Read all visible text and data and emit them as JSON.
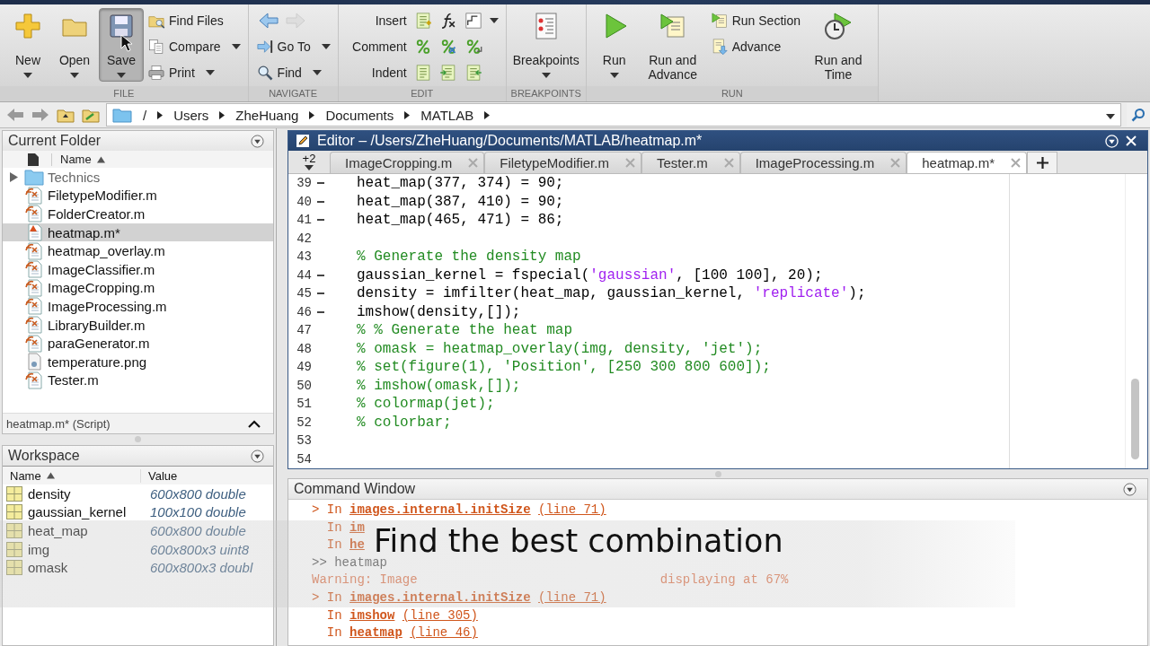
{
  "toolstrip": {
    "sections": [
      {
        "title": "FILE",
        "items": [
          {
            "kind": "large",
            "label": "New",
            "dropdown": true,
            "pressed": false
          },
          {
            "kind": "large",
            "label": "Open",
            "dropdown": true,
            "pressed": false
          },
          {
            "kind": "large",
            "label": "Save",
            "dropdown": true,
            "pressed": true
          },
          {
            "kind": "stack",
            "buttons": [
              {
                "label": "Find Files",
                "dropdown": false
              },
              {
                "label": "Compare",
                "dropdown": true
              },
              {
                "label": "Print",
                "dropdown": true
              }
            ]
          }
        ]
      },
      {
        "title": "NAVIGATE",
        "items": [
          {
            "kind": "stack",
            "buttons": [
              {
                "kind": "arrows",
                "forward_disabled": true
              },
              {
                "label": "Go To",
                "dropdown": true
              },
              {
                "label": "Find",
                "dropdown": true
              }
            ]
          }
        ]
      },
      {
        "title": "EDIT",
        "items": [
          {
            "kind": "rows",
            "rows": [
              {
                "label": "Insert",
                "dropdown": true
              },
              {
                "label": "Comment",
                "dropdown": false
              },
              {
                "label": "Indent",
                "dropdown": false
              }
            ]
          }
        ]
      },
      {
        "title": "BREAKPOINTS",
        "items": [
          {
            "kind": "large",
            "label": "Breakpoints",
            "dropdown": true,
            "pressed": false
          }
        ]
      },
      {
        "title": "RUN",
        "items": [
          {
            "kind": "large",
            "label": "Run",
            "dropdown": true,
            "pressed": false
          },
          {
            "kind": "large",
            "label": "Run and Advance",
            "dropdown": false,
            "pressed": false
          },
          {
            "kind": "stack",
            "buttons": [
              {
                "label": "Run Section",
                "dropdown": false
              },
              {
                "label": "Advance",
                "dropdown": false
              }
            ]
          },
          {
            "kind": "large",
            "label": "Run and Time",
            "dropdown": false,
            "pressed": false
          }
        ]
      }
    ]
  },
  "address_bar": {
    "path": [
      "/",
      "Users",
      "ZheHuang",
      "Documents",
      "MATLAB"
    ]
  },
  "current_folder": {
    "title": "Current Folder",
    "column": "Name",
    "sorted": true,
    "items": [
      {
        "name": "Technics",
        "kind": "folder",
        "selected": false
      },
      {
        "name": "FiletypeModifier.m",
        "kind": "function",
        "selected": false
      },
      {
        "name": "FolderCreator.m",
        "kind": "function",
        "selected": false
      },
      {
        "name": "heatmap.m*",
        "kind": "script",
        "selected": true
      },
      {
        "name": "heatmap_overlay.m",
        "kind": "function",
        "selected": false
      },
      {
        "name": "ImageClassifier.m",
        "kind": "function",
        "selected": false
      },
      {
        "name": "ImageCropping.m",
        "kind": "function",
        "selected": false
      },
      {
        "name": "ImageProcessing.m",
        "kind": "function",
        "selected": false
      },
      {
        "name": "LibraryBuilder.m",
        "kind": "function",
        "selected": false
      },
      {
        "name": "paraGenerator.m",
        "kind": "function",
        "selected": false
      },
      {
        "name": "temperature.png",
        "kind": "image",
        "selected": false
      },
      {
        "name": "Tester.m",
        "kind": "function",
        "selected": false
      }
    ],
    "details": "heatmap.m* (Script)"
  },
  "workspace": {
    "title": "Workspace",
    "columns": [
      {
        "label": "Name",
        "sorted": true
      },
      {
        "label": "Value",
        "sorted": false
      }
    ],
    "rows": [
      {
        "name": "density",
        "value": "600x800 double"
      },
      {
        "name": "gaussian_kernel",
        "value": "100x100 double"
      },
      {
        "name": "heat_map",
        "value": "600x800 double"
      },
      {
        "name": "img",
        "value": "600x800x3 uint8"
      },
      {
        "name": "omask",
        "value": "600x800x3 doubl"
      }
    ]
  },
  "editor": {
    "title": "Editor – /Users/ZheHuang/Documents/MATLAB/heatmap.m*",
    "overflow": "+2",
    "tabs": [
      {
        "label": "ImageCropping.m",
        "selected": false
      },
      {
        "label": "FiletypeModifier.m",
        "selected": false
      },
      {
        "label": "Tester.m",
        "selected": false
      },
      {
        "label": "ImageProcessing.m",
        "selected": false
      },
      {
        "label": "heatmap.m*",
        "selected": true
      }
    ],
    "lines": [
      {
        "number": "39",
        "executable": true,
        "segments": [
          {
            "text": "heat_map(377, 374) = 90;",
            "kind": "code"
          }
        ]
      },
      {
        "number": "40",
        "executable": true,
        "segments": [
          {
            "text": "heat_map(387, 410) = 90;",
            "kind": "code"
          }
        ]
      },
      {
        "number": "41",
        "executable": true,
        "segments": [
          {
            "text": "heat_map(465, 471) = 86;",
            "kind": "code"
          }
        ]
      },
      {
        "number": "42",
        "executable": false
      },
      {
        "number": "43",
        "executable": false,
        "segments": [
          {
            "text": "% Generate the density map",
            "kind": "comment"
          }
        ]
      },
      {
        "number": "44",
        "executable": true,
        "segments": [
          {
            "text": "gaussian_kernel = fspecial(",
            "kind": "code"
          },
          {
            "text": "'gaussian'",
            "kind": "string"
          },
          {
            "text": ", [100 100], 20);",
            "kind": "code"
          }
        ]
      },
      {
        "number": "45",
        "executable": true,
        "segments": [
          {
            "text": "density = imfilter(heat_map, gaussian_kernel, ",
            "kind": "code"
          },
          {
            "text": "'replicate'",
            "kind": "string"
          },
          {
            "text": ");",
            "kind": "code"
          }
        ]
      },
      {
        "number": "46",
        "executable": true,
        "segments": [
          {
            "text": "imshow(density,[]);",
            "kind": "code"
          }
        ]
      },
      {
        "number": "47",
        "executable": false,
        "segments": [
          {
            "text": "% % Generate the heat map",
            "kind": "comment"
          }
        ]
      },
      {
        "number": "48",
        "executable": false,
        "segments": [
          {
            "text": "% omask = heatmap_overlay(img, density, 'jet');",
            "kind": "comment"
          }
        ]
      },
      {
        "number": "49",
        "executable": false,
        "segments": [
          {
            "text": "% set(figure(1), 'Position', [250 300 800 600]);",
            "kind": "comment"
          }
        ]
      },
      {
        "number": "50",
        "executable": false,
        "segments": [
          {
            "text": "% imshow(omask,[]);",
            "kind": "comment"
          }
        ]
      },
      {
        "number": "51",
        "executable": false,
        "segments": [
          {
            "text": "% colormap(jet);",
            "kind": "comment"
          }
        ]
      },
      {
        "number": "52",
        "executable": false,
        "segments": [
          {
            "text": "% colorbar;",
            "kind": "comment"
          }
        ]
      },
      {
        "number": "53",
        "executable": false
      },
      {
        "number": "54",
        "executable": false
      }
    ]
  },
  "command_window": {
    "title": "Command Window",
    "lines": [
      {
        "kind": "error",
        "segments": [
          {
            "text": "> In ",
            "kind": "plain"
          },
          {
            "text": "images.internal.initSize",
            "kind": "bold_link"
          },
          {
            "text": "(line 71)",
            "kind": "link"
          }
        ]
      },
      {
        "kind": "error",
        "segments": [
          {
            "text": "  In ",
            "kind": "plain"
          },
          {
            "text": "im",
            "kind": "bold_link"
          }
        ]
      },
      {
        "kind": "error",
        "segments": [
          {
            "text": "  In ",
            "kind": "plain"
          },
          {
            "text": "he",
            "kind": "bold_link"
          }
        ]
      },
      {
        "kind": "prompt",
        "segments": [
          {
            "text": ">> heatmap",
            "kind": "plain"
          }
        ]
      },
      {
        "kind": "warning",
        "segments": [
          {
            "text": "Warning: Image",
            "kind": "plain"
          },
          {
            "text": "displaying at 67%",
            "kind": "after_gap"
          }
        ]
      },
      {
        "kind": "error",
        "segments": [
          {
            "text": "> In ",
            "kind": "plain"
          },
          {
            "text": "images.internal.initSize",
            "kind": "bold_link"
          },
          {
            "text": "(line 71)",
            "kind": "link"
          }
        ]
      },
      {
        "kind": "error",
        "segments": [
          {
            "text": "  In ",
            "kind": "plain"
          },
          {
            "text": "imshow",
            "kind": "bold_link"
          },
          {
            "text": "(line 305)",
            "kind": "link"
          }
        ]
      },
      {
        "kind": "error",
        "segments": [
          {
            "text": "  In ",
            "kind": "plain"
          },
          {
            "text": "heatmap",
            "kind": "bold_link"
          },
          {
            "text": "(line 46)",
            "kind": "link"
          }
        ]
      }
    ]
  },
  "caption": {
    "text": "Find the best combination"
  }
}
